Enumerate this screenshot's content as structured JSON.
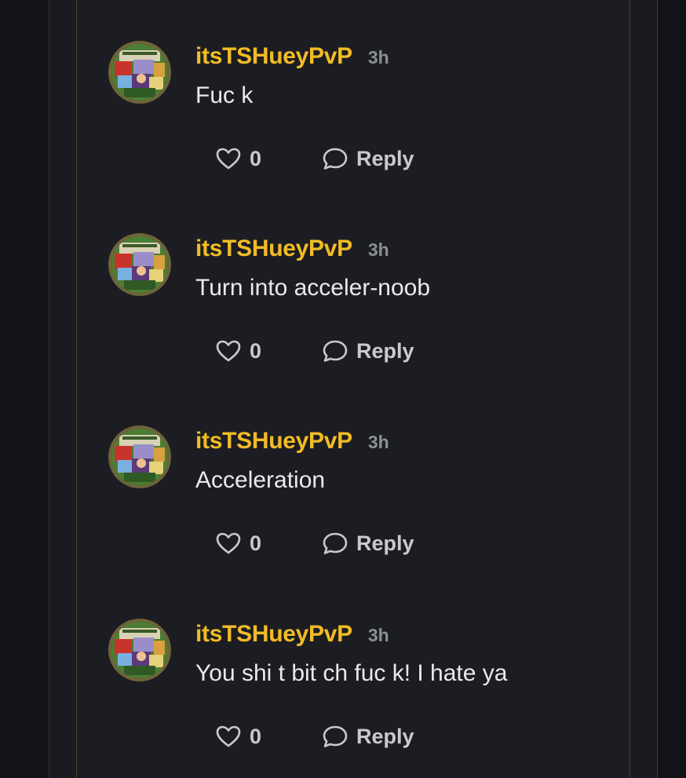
{
  "comments": [
    {
      "username": "itsTSHueyPvP",
      "time": "3h",
      "text": "Fuc k",
      "likes": "0",
      "reply_label": "Reply"
    },
    {
      "username": "itsTSHueyPvP",
      "time": "3h",
      "text": "Turn into acceler-noob",
      "likes": "0",
      "reply_label": "Reply"
    },
    {
      "username": "itsTSHueyPvP",
      "time": "3h",
      "text": "Acceleration",
      "likes": "0",
      "reply_label": "Reply"
    },
    {
      "username": "itsTSHueyPvP",
      "time": "3h",
      "text": "You shi t bit ch fuc k! I hate ya",
      "likes": "0",
      "reply_label": "Reply"
    }
  ],
  "icons": {
    "like": "heart-outline-icon",
    "reply": "speech-bubble-icon"
  },
  "colors": {
    "background": "#17181c",
    "username": "#f2bc24",
    "timestamp": "#8d8f96",
    "text": "#eaeaec",
    "action": "#c9cacf",
    "frame_border": "#4a3f2a"
  }
}
